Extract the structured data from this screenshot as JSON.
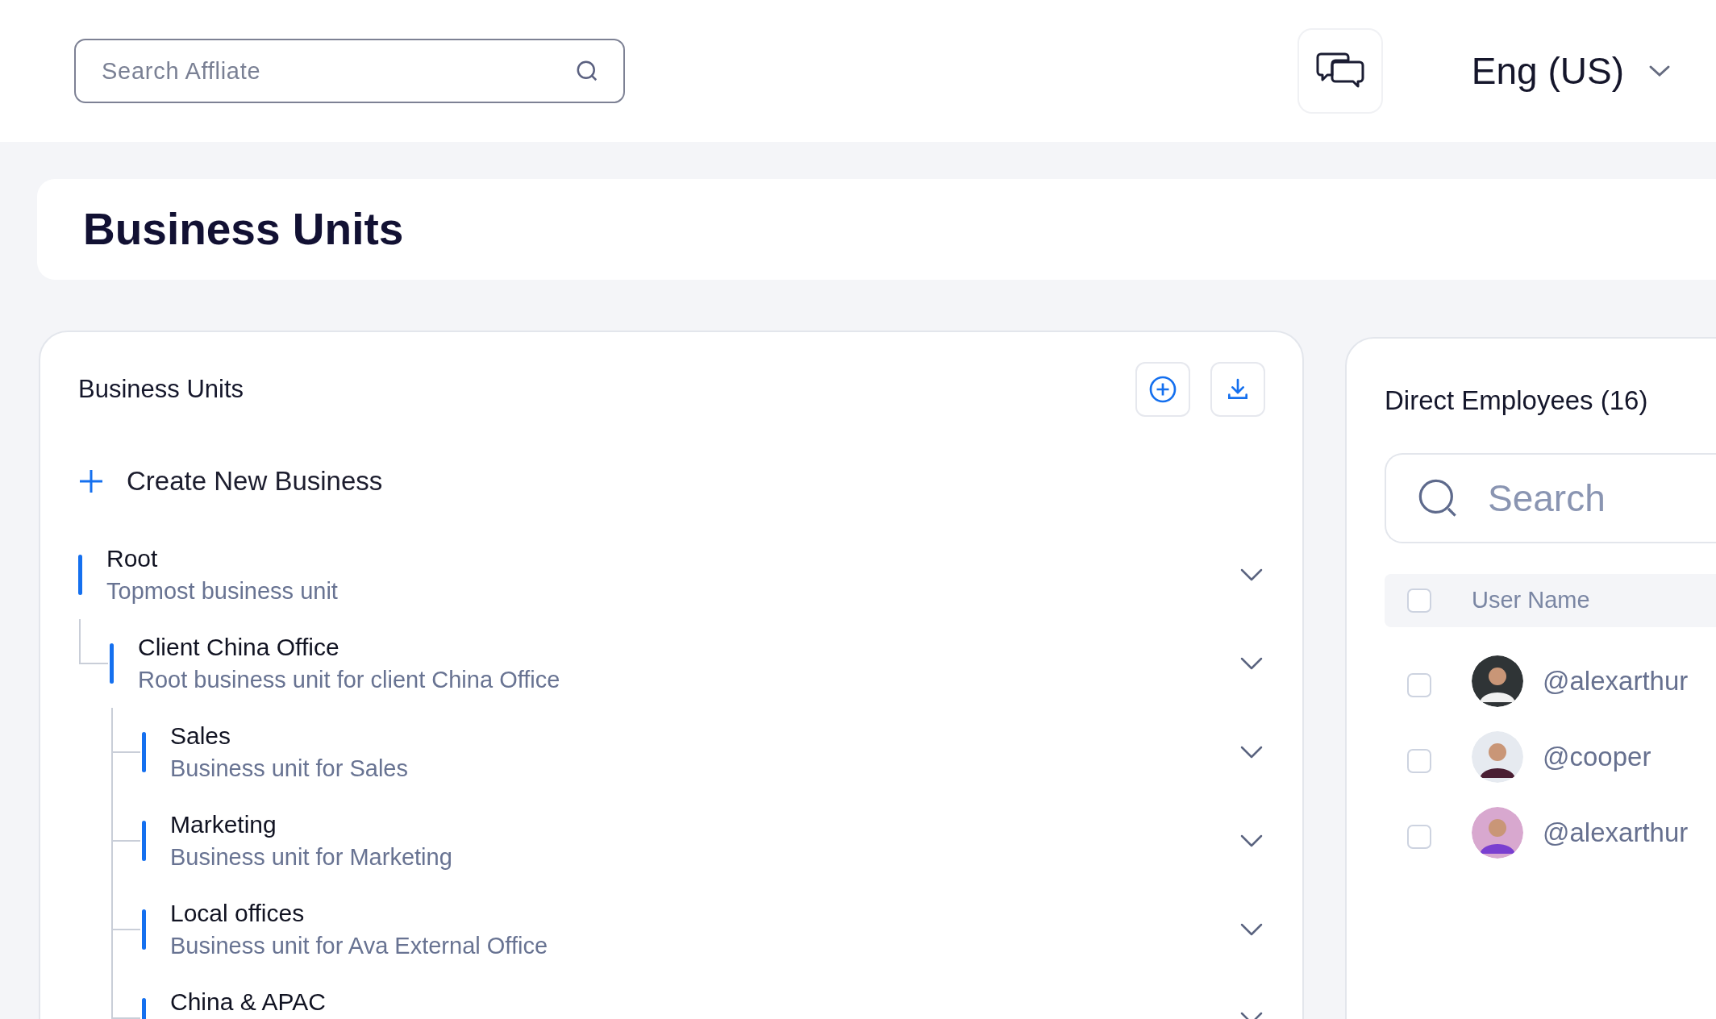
{
  "header": {
    "search": {
      "placeholder": "Search Affliate"
    },
    "language": "Eng (US)"
  },
  "page_title": "Business Units",
  "units_panel": {
    "title": "Business Units",
    "create_label": "Create New Business",
    "tree": [
      {
        "name": "Root",
        "description": "Topmost business unit",
        "children": [
          {
            "name": "Client China Office",
            "description": "Root business unit for client China Office",
            "children": [
              {
                "name": "Sales",
                "description": "Business unit for Sales"
              },
              {
                "name": "Marketing",
                "description": "Business unit for Marketing"
              },
              {
                "name": "Local offices",
                "description": "Business unit for Ava External Office"
              },
              {
                "name": "China & APAC"
              }
            ]
          }
        ]
      }
    ]
  },
  "employees_panel": {
    "title": "Direct Employees (16)",
    "search": {
      "placeholder": "Search"
    },
    "columns": [
      "User Name"
    ],
    "header_checked": false,
    "rows": [
      {
        "user": "@alexarthur",
        "checked": false
      },
      {
        "user": "@cooper",
        "checked": false
      },
      {
        "user": "@alexarthur",
        "checked": false
      }
    ]
  }
}
